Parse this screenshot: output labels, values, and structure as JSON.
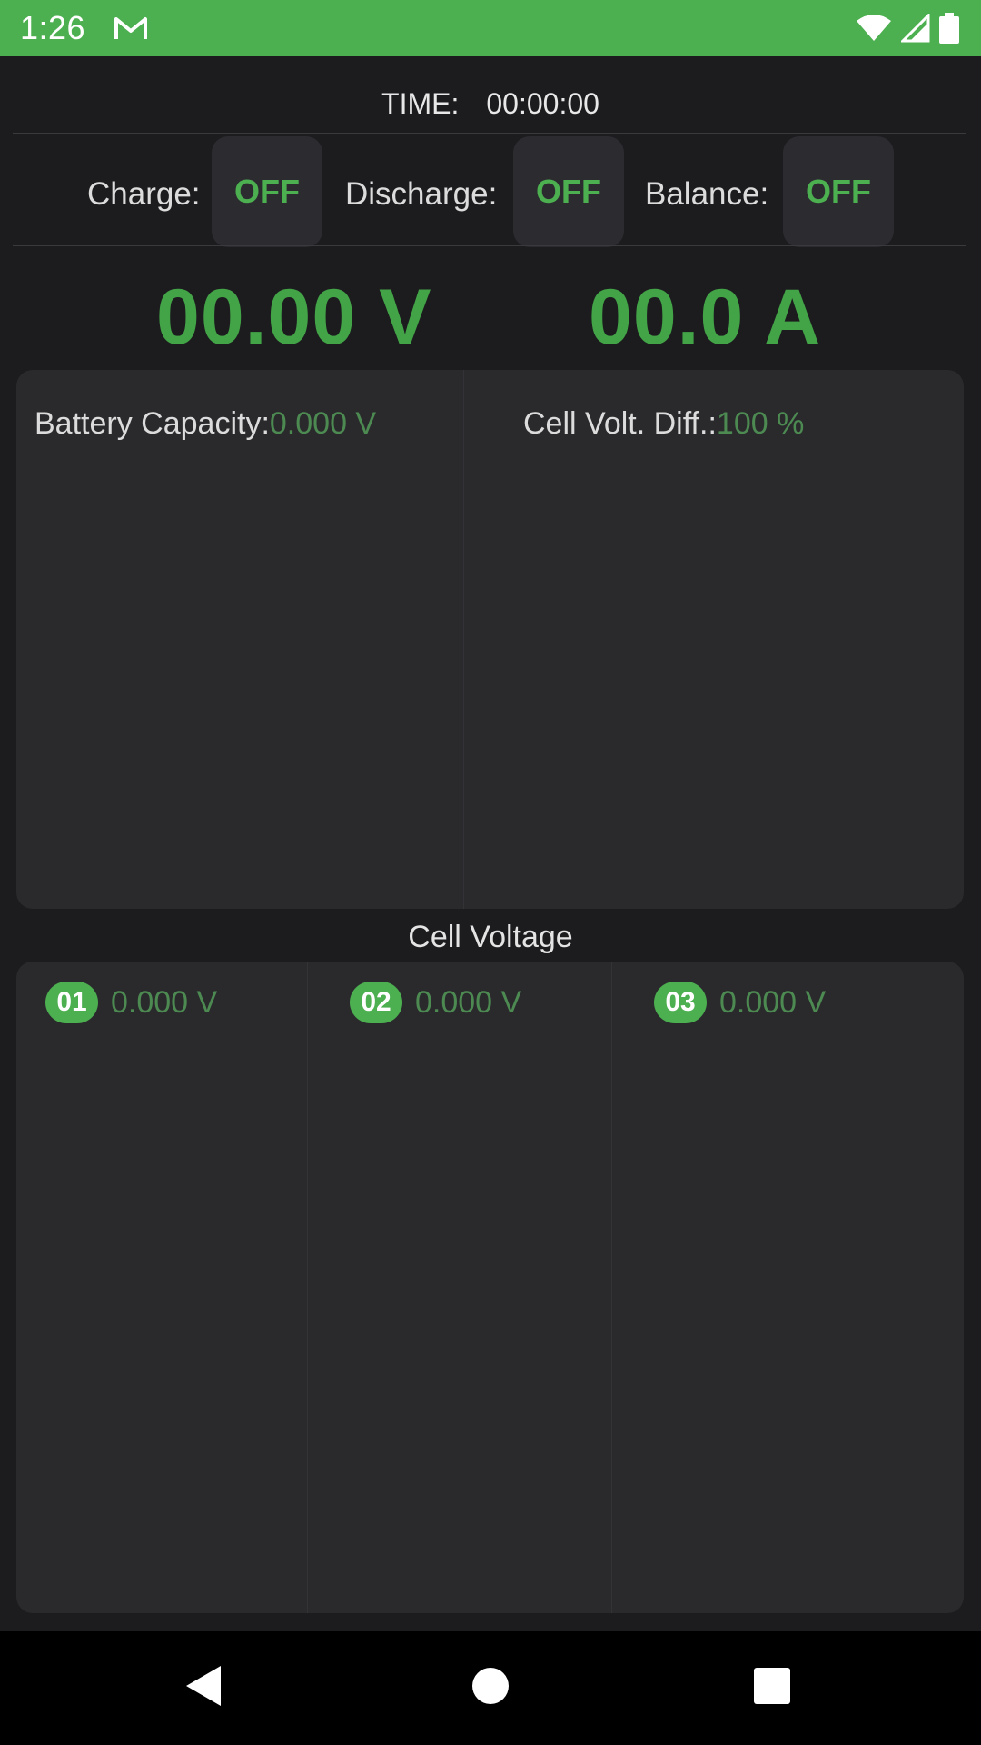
{
  "status_bar": {
    "time": "1:26",
    "icons": [
      "gmail-icon",
      "wifi-icon",
      "signal-icon",
      "battery-icon"
    ],
    "color": "#4caf50"
  },
  "timer": {
    "label": "TIME:",
    "value": "00:00:00"
  },
  "toggles": [
    {
      "label": "Charge:",
      "state": "OFF"
    },
    {
      "label": "Discharge:",
      "state": "OFF"
    },
    {
      "label": "Balance:",
      "state": "OFF"
    }
  ],
  "readouts": {
    "voltage": "00.00 V",
    "current": "00.0 A"
  },
  "battery_info": {
    "capacity_label": "Battery Capacity:",
    "capacity_value": "0.000 V",
    "diff_label": "Cell Volt. Diff.:",
    "diff_value": "100 %"
  },
  "cell_voltage": {
    "title": "Cell Voltage",
    "cells": [
      {
        "id": "01",
        "value": "0.000 V"
      },
      {
        "id": "02",
        "value": "0.000 V"
      },
      {
        "id": "03",
        "value": "0.000 V"
      }
    ]
  },
  "nav": {
    "icons": [
      "back-icon",
      "home-icon",
      "recents-icon"
    ]
  },
  "colors": {
    "accent": "#4caf50",
    "background": "#1c1c1f",
    "panel": "#2a2a2d"
  }
}
